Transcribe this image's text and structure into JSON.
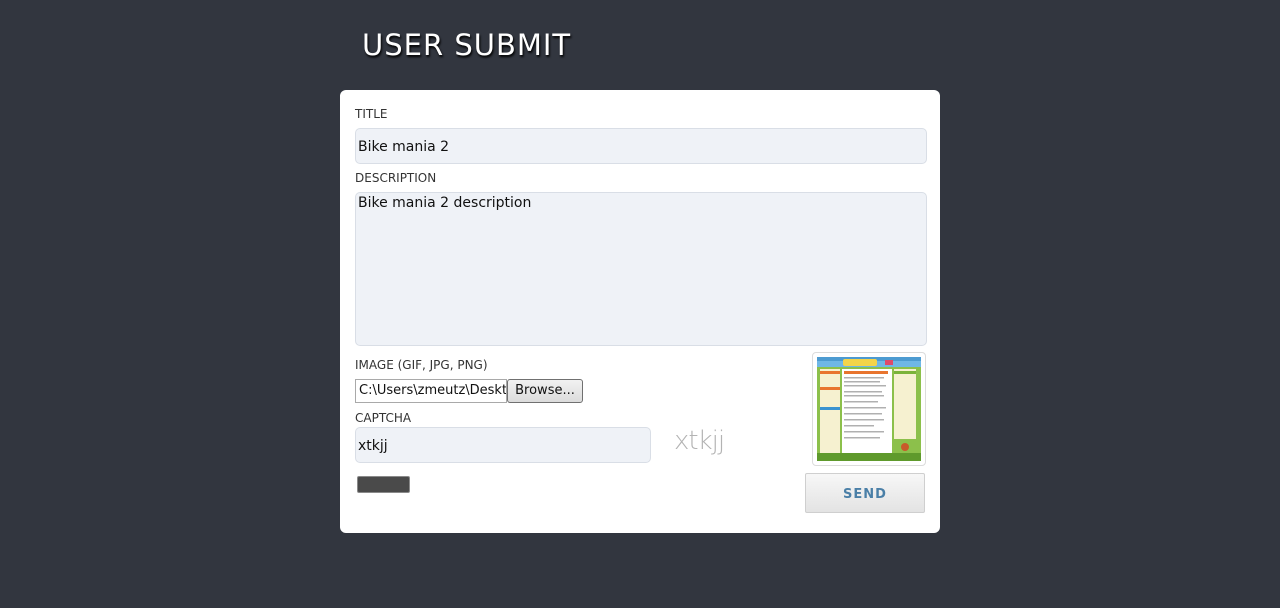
{
  "page": {
    "title": "USER SUBMIT"
  },
  "form": {
    "title_label": "TITLE",
    "title_value": "Bike mania 2",
    "description_label": "DESCRIPTION",
    "description_value": "Bike mania 2 description",
    "image_label": "IMAGE (GIF, JPG, PNG)",
    "file_path": "C:\\Users\\zmeutz\\Deskt",
    "browse_label": "Browse...",
    "captcha_label": "CAPTCHA",
    "captcha_value": "xtkjj",
    "captcha_image_text": "xtkjj",
    "send_label": "SEND"
  },
  "colors": {
    "background": "#32363f",
    "panel": "#ffffff",
    "field": "#eff2f7",
    "send_text": "#4a7fa7"
  },
  "icons": {
    "image_preview": "website-screenshot-thumbnail"
  }
}
